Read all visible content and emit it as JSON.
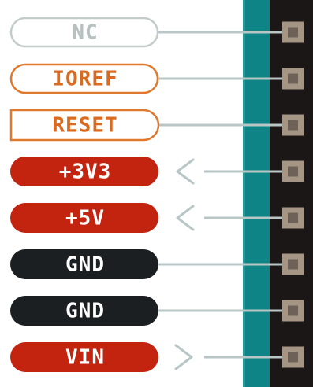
{
  "header": {
    "pins": [
      {
        "label": "NC",
        "style": "nc",
        "shape": "pill",
        "direction": "none"
      },
      {
        "label": "IOREF",
        "style": "io",
        "shape": "pill",
        "direction": "none"
      },
      {
        "label": "RESET",
        "style": "io",
        "shape": "tab",
        "direction": "none"
      },
      {
        "label": "+3V3",
        "style": "power",
        "shape": "pill",
        "direction": "out"
      },
      {
        "label": "+5V",
        "style": "power",
        "shape": "pill",
        "direction": "out"
      },
      {
        "label": "GND",
        "style": "ground",
        "shape": "pill",
        "direction": "none"
      },
      {
        "label": "GND",
        "style": "ground",
        "shape": "pill",
        "direction": "none"
      },
      {
        "label": "VIN",
        "style": "power",
        "shape": "pill",
        "direction": "in"
      }
    ]
  },
  "colors": {
    "nc_fill": "#ffffff",
    "nc_stroke": "#c4cbcb",
    "nc_text": "#b7c0c0",
    "io_fill": "#ffffff",
    "io_stroke": "#e0782e",
    "io_text": "#d96a1f",
    "power_fill": "#c3240f",
    "power_text": "#ffffff",
    "ground_fill": "#1c1f22",
    "ground_text": "#ffffff",
    "wire": "#b9c6c6",
    "arrow": "#b9c6c6",
    "board": "#0e8486",
    "header_body": "#1b1716",
    "pin_metal": "#a59585",
    "pin_hole": "#6e6258"
  }
}
